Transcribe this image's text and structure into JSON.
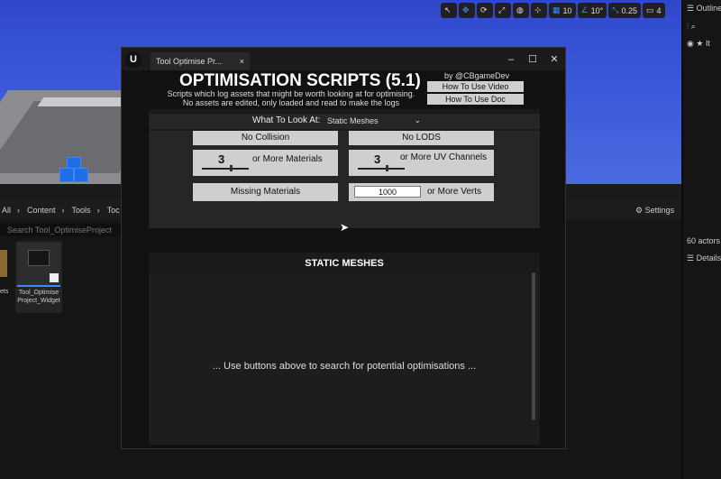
{
  "viewport": {
    "toolbar": {
      "grid_size": "10",
      "rotation_snap": "10°",
      "scale_snap": "0.25",
      "camera_speed": "4"
    }
  },
  "outliner": {
    "title": "Outline",
    "item_partial": "It",
    "actor_count": "60 actors",
    "details_label": "Details"
  },
  "content_browser": {
    "breadcrumbs": [
      "All",
      "Content",
      "Tools",
      "Toc"
    ],
    "search_placeholder": "Search Tool_OptimiseProject",
    "settings_label": "Settings",
    "left_tile_label": "ets",
    "asset_label": "Tool_Optimise Project_Widget"
  },
  "window": {
    "tab_title": "Tool Optimise Pr...",
    "close_tab": "×",
    "title": "OPTIMISATION SCRIPTS (5.1)",
    "subtitle": "Scripts which log assets that might be worth looking at for optimising. No assets are edited, only loaded and read to make the logs",
    "by_line": "by @CBgameDev",
    "how_to_video": "How To Use Video",
    "how_to_doc": "How To Use Doc",
    "look_at_label": "What To Look At:",
    "look_at_value": "Static Meshes",
    "buttons": {
      "no_collision": "No Collision",
      "no_lods": "No LODS",
      "materials_count": "3",
      "materials_label": "or More Materials",
      "uv_count": "3",
      "uv_label": "or More UV Channels",
      "missing_materials": "Missing Materials",
      "verts_value": "1000",
      "verts_label": "or More Verts"
    },
    "results_heading": "STATIC MESHES",
    "results_message": "... Use buttons above to search for potential optimisations ..."
  },
  "colors": {
    "accent": "#3f88ff",
    "button_bg": "#cfcfcf"
  }
}
